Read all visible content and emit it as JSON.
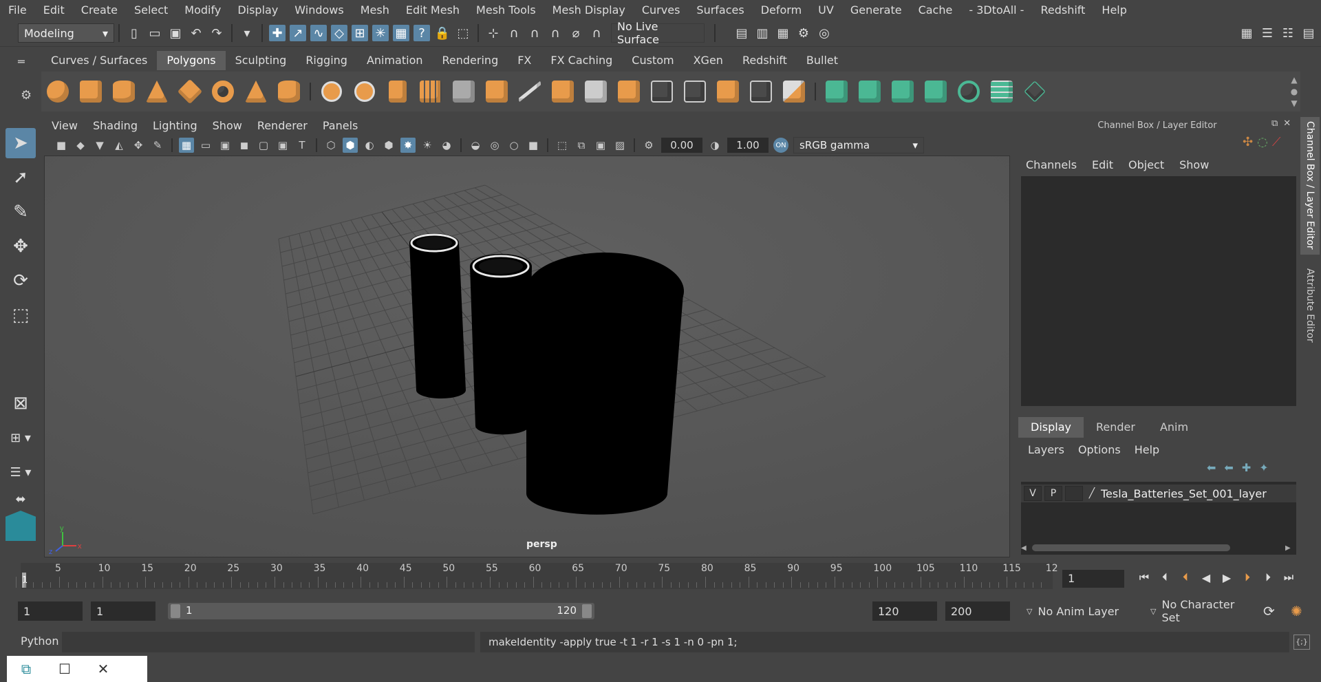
{
  "menubar": [
    "File",
    "Edit",
    "Create",
    "Select",
    "Modify",
    "Display",
    "Windows",
    "Mesh",
    "Edit Mesh",
    "Mesh Tools",
    "Mesh Display",
    "Curves",
    "Surfaces",
    "Deform",
    "UV",
    "Generate",
    "Cache",
    "- 3DtoAll -",
    "Redshift",
    "Help"
  ],
  "status": {
    "mode": "Modeling",
    "live_surface": "No Live Surface"
  },
  "shelf_tabs": [
    "Curves / Surfaces",
    "Polygons",
    "Sculpting",
    "Rigging",
    "Animation",
    "Rendering",
    "FX",
    "FX Caching",
    "Custom",
    "XGen",
    "Redshift",
    "Bullet"
  ],
  "shelf_active": "Polygons",
  "viewport": {
    "menu": [
      "View",
      "Shading",
      "Lighting",
      "Show",
      "Renderer",
      "Panels"
    ],
    "exposure": "0.00",
    "gamma": "1.00",
    "colorspace": "sRGB gamma",
    "camera_label": "persp"
  },
  "right_panel": {
    "title": "Channel Box / Layer Editor",
    "menu": [
      "Channels",
      "Edit",
      "Object",
      "Show"
    ],
    "layer_tabs": [
      "Display",
      "Render",
      "Anim"
    ],
    "layer_menu": [
      "Layers",
      "Options",
      "Help"
    ],
    "layer": {
      "v": "V",
      "p": "P",
      "name": "Tesla_Batteries_Set_001_layer"
    },
    "side_tabs": [
      "Channel Box / Layer Editor",
      "Attribute Editor"
    ]
  },
  "timeline": {
    "ticks": [
      "5",
      "10",
      "15",
      "20",
      "25",
      "30",
      "35",
      "40",
      "45",
      "50",
      "55",
      "60",
      "65",
      "70",
      "75",
      "80",
      "85",
      "90",
      "95",
      "100",
      "105",
      "110",
      "115",
      "12"
    ],
    "start_marker": "1",
    "current_frame": "1"
  },
  "range": {
    "start": "1",
    "playback_start": "1",
    "slider_start": "1",
    "slider_end": "120",
    "playback_end": "120",
    "end": "200",
    "anim_layer": "No Anim Layer",
    "character_set": "No Character Set"
  },
  "command": {
    "language": "Python",
    "result": "makeIdentity -apply true -t 1 -r 1 -s 1 -n 0 -pn 1;"
  },
  "colors": {
    "accent": "#5b86a6",
    "shelf_orange": "#e89b4b",
    "shelf_green": "#4bb894",
    "viewport_bg": "#5a5a5a"
  }
}
